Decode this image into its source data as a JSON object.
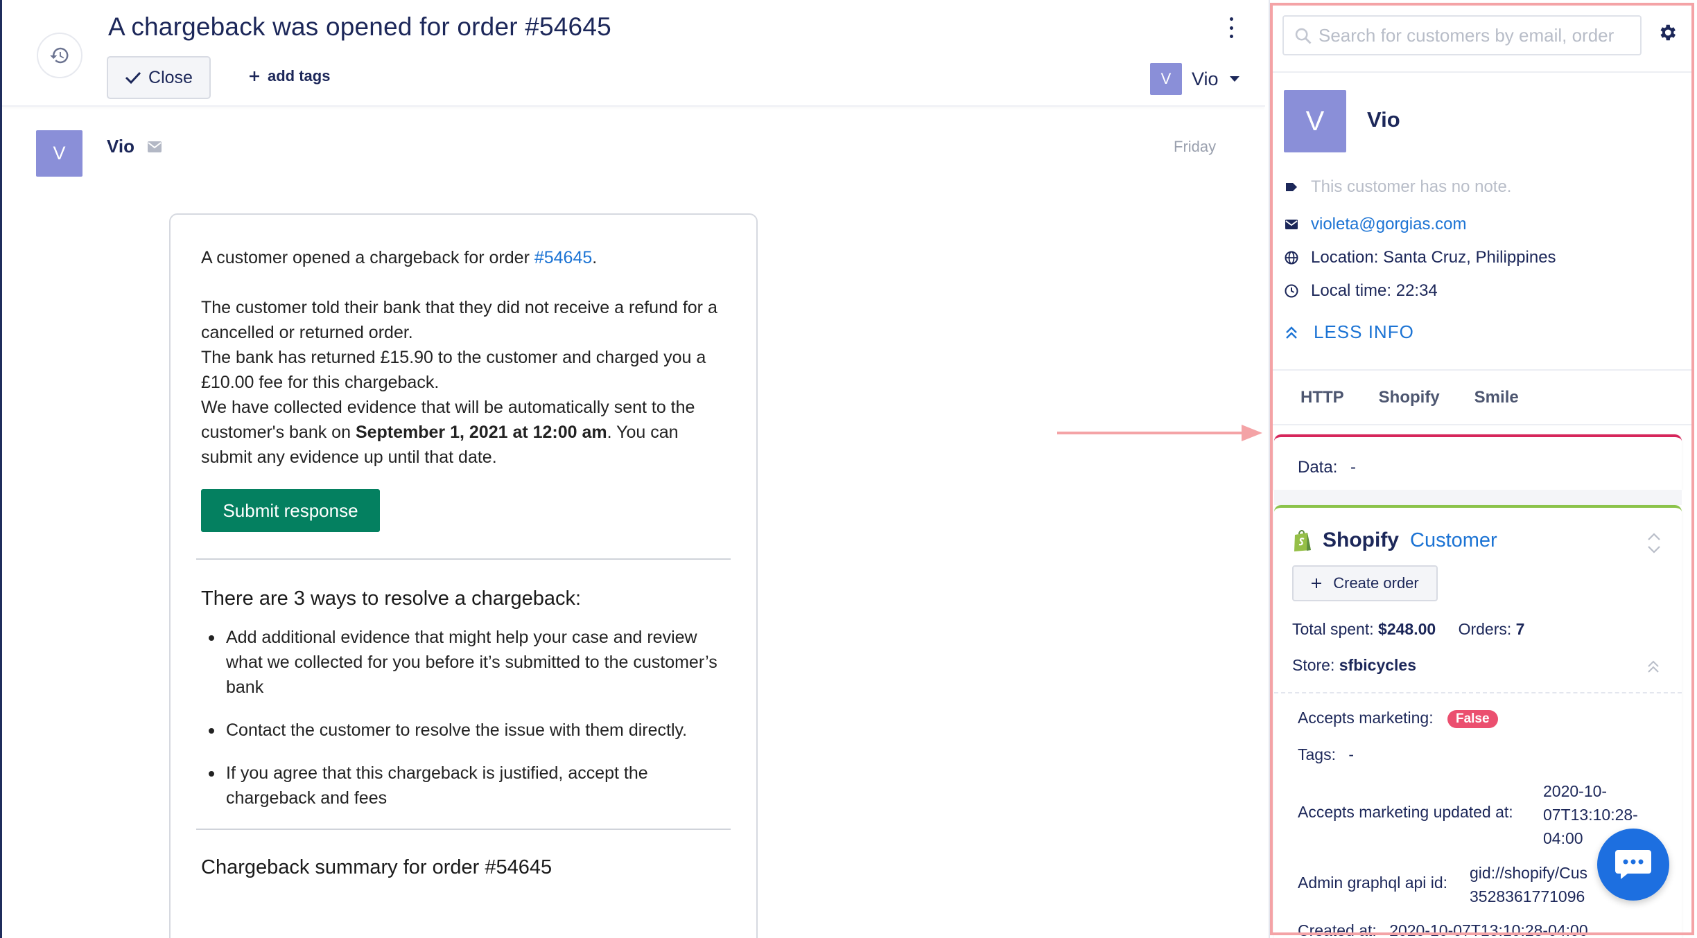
{
  "ticket": {
    "title": "A chargeback was opened for order #54645",
    "close_label": "Close",
    "add_tags_label": "add tags",
    "assignee": {
      "initial": "V",
      "name": "Vio"
    }
  },
  "message": {
    "avatar_initial": "V",
    "sender": "Vio",
    "date": "Friday",
    "intro_pre": "A customer opened a chargeback for order ",
    "intro_link": "#54645",
    "intro_post": ".",
    "para1": "The customer told their bank that they did not receive a refund for a cancelled or returned order.",
    "para2": "The bank has returned £15.90 to the customer and charged you a £10.00 fee for this chargeback.",
    "para3_pre": "We have collected evidence that will be automatically sent to the customer's bank on ",
    "para3_bold": "September 1, 2021 at 12:00 am",
    "para3_post": ". You can submit any evidence up until that date.",
    "submit_label": "Submit response",
    "ways_heading": "There are 3 ways to resolve a chargeback:",
    "ways": [
      "Add additional evidence that might help your case and review what we collected for you before it’s submitted to the customer’s bank",
      "Contact the customer to resolve the issue with them directly.",
      "If you agree that this chargeback is justified, accept the chargeback and fees"
    ],
    "summary_heading": "Chargeback summary for order #54645"
  },
  "sidebar": {
    "search_placeholder": "Search for customers by email, order",
    "customer": {
      "initial": "V",
      "name": "Vio",
      "note": "This customer has no note.",
      "email": "violeta@gorgias.com",
      "location": "Location: Santa Cruz, Philippines",
      "local_time": "Local time: 22:34"
    },
    "less_info_label": "LESS INFO",
    "tabs": [
      "HTTP",
      "Shopify",
      "Smile"
    ],
    "http": {
      "data_label": "Data:",
      "data_value": "-"
    },
    "shopify": {
      "title": "Shopify",
      "subtitle": "Customer",
      "create_order_label": "Create order",
      "total_spent_label": "Total spent:",
      "total_spent_value": "$248.00",
      "orders_label": "Orders:",
      "orders_value": "7",
      "store_label": "Store:",
      "store_value": "sfbicycles",
      "accepts_marketing_label": "Accepts marketing:",
      "accepts_marketing_value": "False",
      "tags_label": "Tags:",
      "tags_value": "-",
      "am_updated_label": "Accepts marketing updated at:",
      "am_updated_line1": "2020-10-",
      "am_updated_line2": "07T13:10:28-",
      "am_updated_line3": "04:00",
      "admin_gql_label": "Admin graphql api id:",
      "admin_gql_line1": "gid://shopify/Cus",
      "admin_gql_line2": "3528361771096",
      "created_label": "Created at:",
      "created_value": "2020-10-07T13:10:28-04:00"
    }
  },
  "colors": {
    "brand_navy": "#1c2759",
    "link_blue": "#1b73d4",
    "submit_green": "#048060",
    "avatar_purple": "#8a8fd8",
    "highlight_pink": "#f4a3a6",
    "http_accent": "#d6265b",
    "shopify_accent": "#8bc34a",
    "false_badge": "#eb4f6f"
  }
}
